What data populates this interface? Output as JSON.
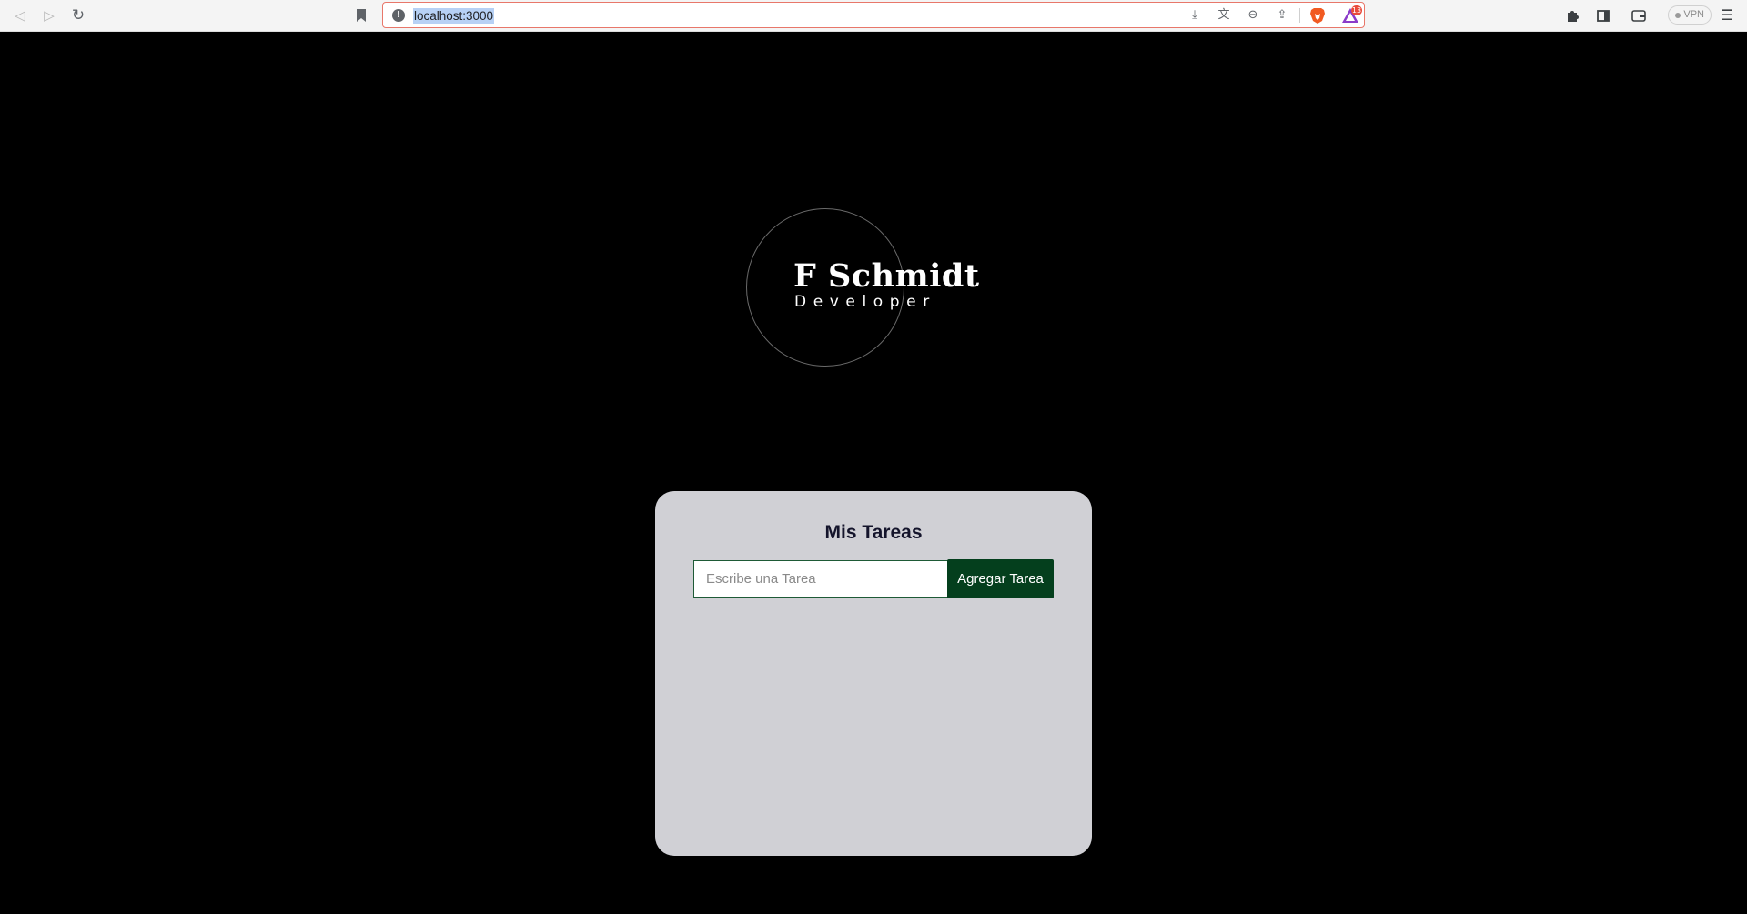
{
  "browser": {
    "url": "localhost:3000",
    "icons": {
      "back": "back-arrow-icon",
      "forward": "forward-arrow-icon",
      "reload": "reload-icon",
      "bookmark": "bookmark-icon",
      "site_info": "site-info-icon",
      "download": "download-icon",
      "translate": "translate-icon",
      "zoom": "zoom-out-icon",
      "share": "share-icon",
      "brave_shields": "brave-lion-icon",
      "brave_rewards": "brave-rewards-icon",
      "extensions": "puzzle-icon",
      "sidebar": "sidebar-icon",
      "wallet": "wallet-icon",
      "menu": "hamburger-menu-icon"
    },
    "rewards_badge": "13",
    "vpn_label": "VPN",
    "accent_color": "#e8776a"
  },
  "logo": {
    "name": "F Schmidt",
    "role": "Developer"
  },
  "todo": {
    "title": "Mis Tareas",
    "input_placeholder": "Escribe una Tarea",
    "input_value": "",
    "add_button_label": "Agregar Tarea",
    "items": [],
    "colors": {
      "card_bg": "#d0d0d5",
      "button_bg": "#043f1d",
      "page_bg": "#000000"
    }
  }
}
